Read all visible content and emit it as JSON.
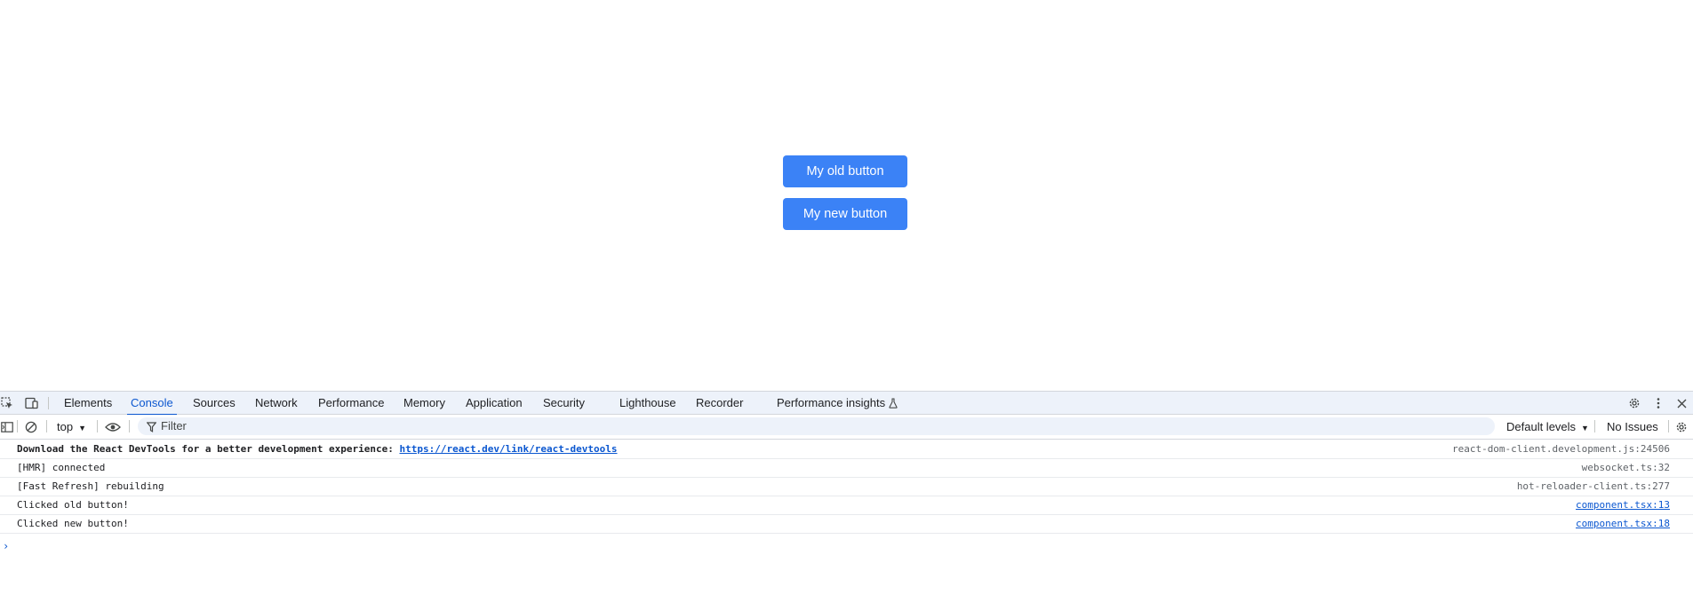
{
  "page": {
    "old_button_label": "My old button",
    "new_button_label": "My new button",
    "button_color": "#3b82f6"
  },
  "devtools": {
    "tabs": [
      {
        "label": "Elements"
      },
      {
        "label": "Console",
        "active": true
      },
      {
        "label": "Sources"
      },
      {
        "label": "Network"
      },
      {
        "label": "Performance"
      },
      {
        "label": "Memory"
      },
      {
        "label": "Application"
      },
      {
        "label": "Security"
      },
      {
        "label": "Lighthouse"
      },
      {
        "label": "Recorder"
      },
      {
        "label": "Performance insights"
      }
    ],
    "accent_color": "#0b57d0",
    "filterbar": {
      "context": "top",
      "filter_placeholder": "Filter",
      "levels": "Default levels",
      "issues": "No Issues"
    },
    "messages": [
      {
        "prefix": "Download the React DevTools for a better development experience: ",
        "link": "https://react.dev/link/react-devtools",
        "source": "react-dom-client.development.js:24506"
      },
      {
        "text": "[HMR] connected",
        "source": "websocket.ts:32"
      },
      {
        "text": "[Fast Refresh] rebuilding",
        "source": "hot-reloader-client.ts:277"
      },
      {
        "text": "Clicked old button!",
        "source": "component.tsx:13"
      },
      {
        "text": "Clicked new button!",
        "source": "component.tsx:18"
      }
    ],
    "prompt": "›"
  }
}
